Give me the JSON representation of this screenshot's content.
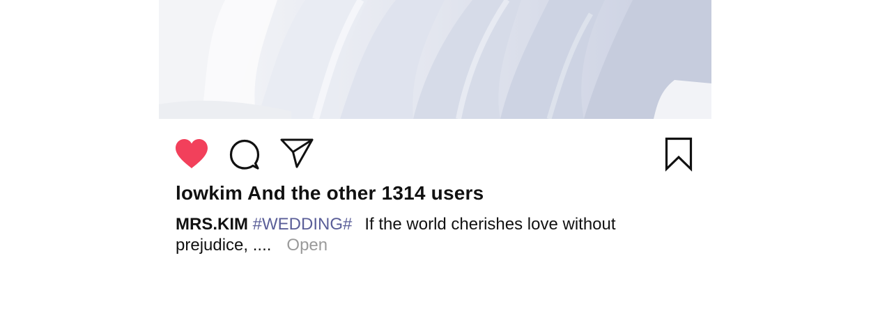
{
  "post": {
    "image": {
      "subject": "white silk fabric folds",
      "colors": {
        "light": "#f4f5f8",
        "mid": "#d4d9e6",
        "shadow": "#b9c0d6"
      }
    },
    "actions": {
      "like_icon": "heart-filled-icon",
      "like_color": "#f2405b",
      "comment_icon": "speech-bubble-icon",
      "share_icon": "paper-plane-icon",
      "save_icon": "bookmark-icon"
    },
    "likes_text": "lowkim And the other 1314 users",
    "caption": {
      "username": "MRS.KIM",
      "hashtag": "#WEDDING#",
      "text": "If the world cherishes love without prejudice, ....",
      "more_label": "Open"
    },
    "colors": {
      "text": "#111111",
      "hashtag": "#5a5e98",
      "muted": "#9a9a9a"
    }
  }
}
